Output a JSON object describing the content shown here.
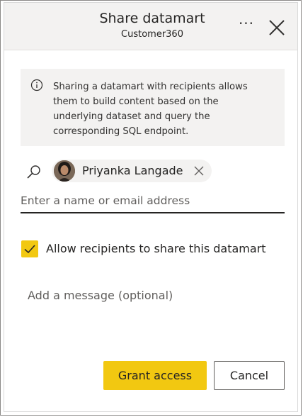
{
  "dialog": {
    "title": "Share datamart",
    "subtitle": "Customer360",
    "more_label": "···"
  },
  "info": {
    "icon": "info-icon",
    "text": "Sharing a datamart with recipients allows\nthem to build content based on the\nunderlying dataset and query the\ncorresponding SQL endpoint."
  },
  "recipients": {
    "search_icon": "search-icon",
    "chips": [
      {
        "name": "Priyanka Langade",
        "avatar": "user-avatar-photo",
        "remove_icon": "close-icon"
      }
    ],
    "input_placeholder": "Enter a name or email address",
    "input_value": ""
  },
  "options": {
    "allow_reshare_label": "Allow recipients to share this datamart",
    "allow_reshare_checked": true,
    "check_color": "#f2c811"
  },
  "message": {
    "placeholder": "Add a message (optional)",
    "value": ""
  },
  "actions": {
    "grant_label": "Grant access",
    "cancel_label": "Cancel",
    "primary_color": "#f2c811"
  }
}
